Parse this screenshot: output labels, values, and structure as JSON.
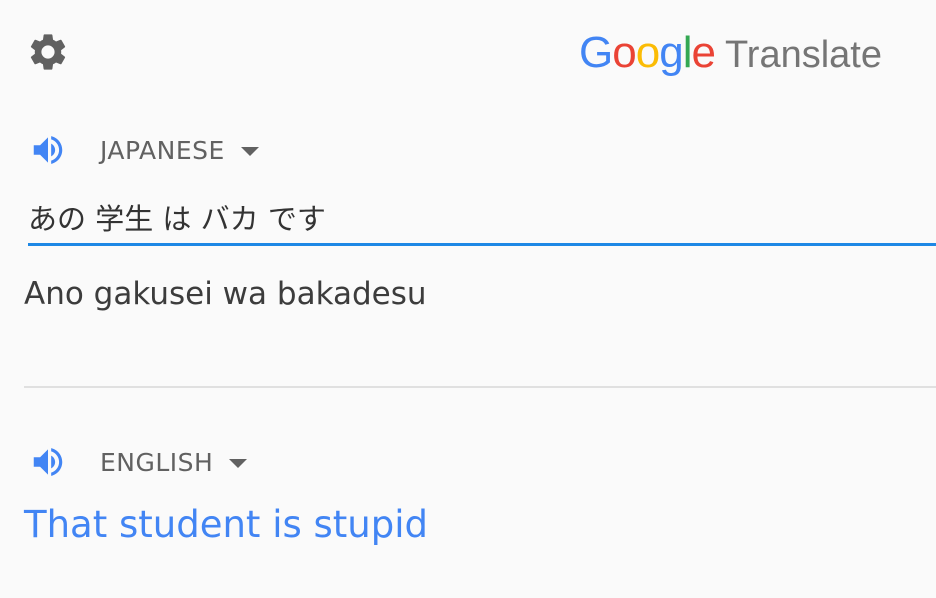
{
  "header": {
    "settings_icon": "gear-icon",
    "brand": {
      "letters": [
        {
          "char": "G",
          "color": "#4285F4"
        },
        {
          "char": "o",
          "color": "#EA4335"
        },
        {
          "char": "o",
          "color": "#FBBC05"
        },
        {
          "char": "g",
          "color": "#4285F4"
        },
        {
          "char": "l",
          "color": "#34A853"
        },
        {
          "char": "e",
          "color": "#EA4335"
        }
      ],
      "product": "Translate"
    }
  },
  "source": {
    "speaker_icon": "speaker-icon",
    "language": "JAPANESE",
    "text": "あの 学生 は バカ です",
    "romanization": "Ano gakusei wa bakadesu"
  },
  "target": {
    "speaker_icon": "speaker-icon",
    "language": "ENGLISH",
    "translation": "That student is stupid"
  },
  "colors": {
    "accent": "#4285f4",
    "input_underline": "#1e88e5",
    "icon_gray": "#616161"
  }
}
